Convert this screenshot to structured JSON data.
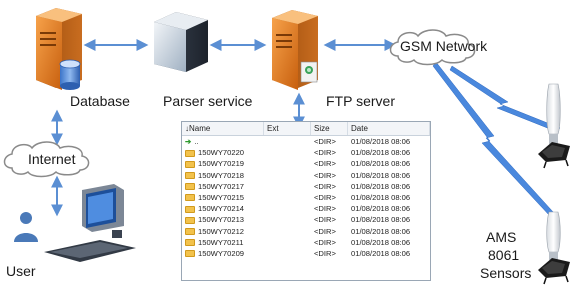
{
  "labels": {
    "database": "Database",
    "parser": "Parser service",
    "ftp": "FTP server",
    "gsm": "GSM Network",
    "internet": "Internet",
    "user": "User",
    "ams1": "AMS",
    "ams2": "8061",
    "ams3": "Sensors"
  },
  "file_list": {
    "columns": [
      "Name",
      "Ext",
      "Size",
      "Date"
    ],
    "rows": [
      {
        "name": "..",
        "ext": "",
        "size": "<DIR>",
        "date": "01/08/2018 08:06",
        "type": "up"
      },
      {
        "name": "150WY70220",
        "ext": "",
        "size": "<DIR>",
        "date": "01/08/2018 08:06",
        "type": "folder"
      },
      {
        "name": "150WY70219",
        "ext": "",
        "size": "<DIR>",
        "date": "01/08/2018 08:06",
        "type": "folder"
      },
      {
        "name": "150WY70218",
        "ext": "",
        "size": "<DIR>",
        "date": "01/08/2018 08:06",
        "type": "folder"
      },
      {
        "name": "150WY70217",
        "ext": "",
        "size": "<DIR>",
        "date": "01/08/2018 08:06",
        "type": "folder"
      },
      {
        "name": "150WY70215",
        "ext": "",
        "size": "<DIR>",
        "date": "01/08/2018 08:06",
        "type": "folder"
      },
      {
        "name": "150WY70214",
        "ext": "",
        "size": "<DIR>",
        "date": "01/08/2018 08:06",
        "type": "folder"
      },
      {
        "name": "150WY70213",
        "ext": "",
        "size": "<DIR>",
        "date": "01/08/2018 08:06",
        "type": "folder"
      },
      {
        "name": "150WY70212",
        "ext": "",
        "size": "<DIR>",
        "date": "01/08/2018 08:06",
        "type": "folder"
      },
      {
        "name": "150WY70211",
        "ext": "",
        "size": "<DIR>",
        "date": "01/08/2018 08:06",
        "type": "folder"
      },
      {
        "name": "150WY70209",
        "ext": "",
        "size": "<DIR>",
        "date": "01/08/2018 08:06",
        "type": "folder"
      }
    ]
  },
  "colors": {
    "connector": "#5b8fd3",
    "cloud_stroke": "#8a8a8a",
    "server_orange": "#e07a1c",
    "sensor_dark": "#222222"
  }
}
